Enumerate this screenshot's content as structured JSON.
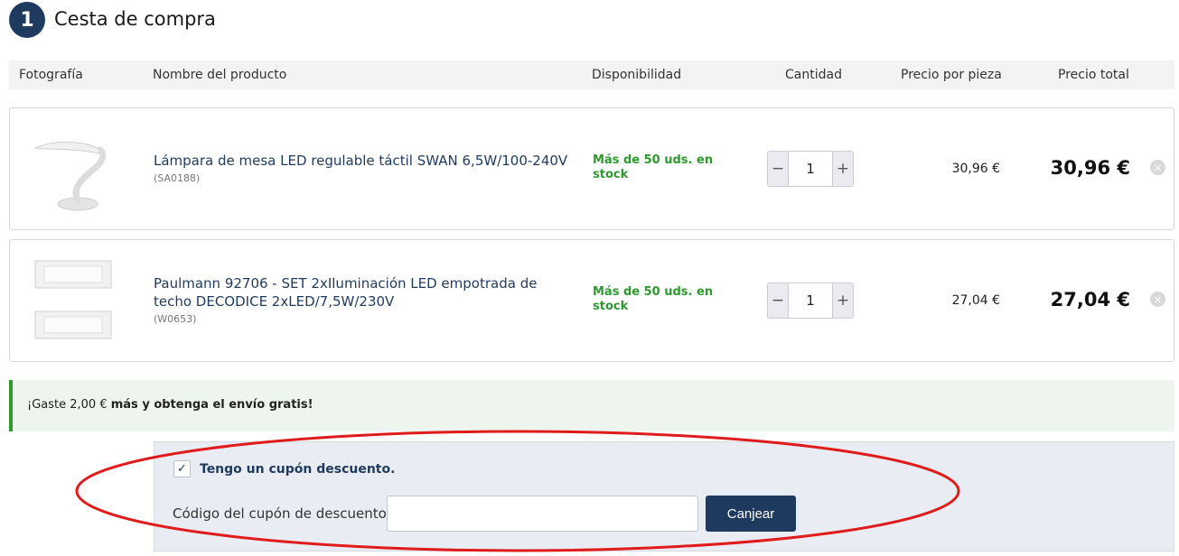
{
  "header": {
    "step_number": "1",
    "title": "Cesta de compra"
  },
  "columns": [
    "Fotografía",
    "Nombre del producto",
    "Disponibilidad",
    "Cantidad",
    "Precio por pieza",
    "Precio total"
  ],
  "items": [
    {
      "name": "Lámpara de mesa LED regulable táctil SWAN 6,5W/100-240V",
      "code": "(SA0188)",
      "availability": "Más de 50 uds. en stock",
      "quantity": "1",
      "unit_price": "30,96 €",
      "total_price": "30,96 €",
      "image_icon": "desk-lamp"
    },
    {
      "name": "Paulmann 92706 - SET 2xIluminación LED empotrada de techo DECODICE 2xLED/7,5W/230V",
      "code": "(W0653)",
      "availability": "Más de 50 uds. en stock",
      "quantity": "1",
      "unit_price": "27,04 €",
      "total_price": "27,04 €",
      "image_icon": "ceiling-panel-lights"
    }
  ],
  "qty_controls": {
    "minus": "−",
    "plus": "+"
  },
  "remove_symbol": "×",
  "free_shipping": {
    "prefix": "¡Gaste 2,00 € ",
    "bold": "más y obtenga el envío gratis!"
  },
  "coupon": {
    "checkbox_mark": "✓",
    "checked": true,
    "label": "Tengo un cupón descuento.",
    "code_label": "Código del cupón de descuento",
    "code_value": "",
    "redeem_label": "Canjear"
  },
  "colors": {
    "brand_navy": "#1f3a5f",
    "stock_green": "#2e9a2e",
    "annotation_red": "#e01b1b"
  }
}
